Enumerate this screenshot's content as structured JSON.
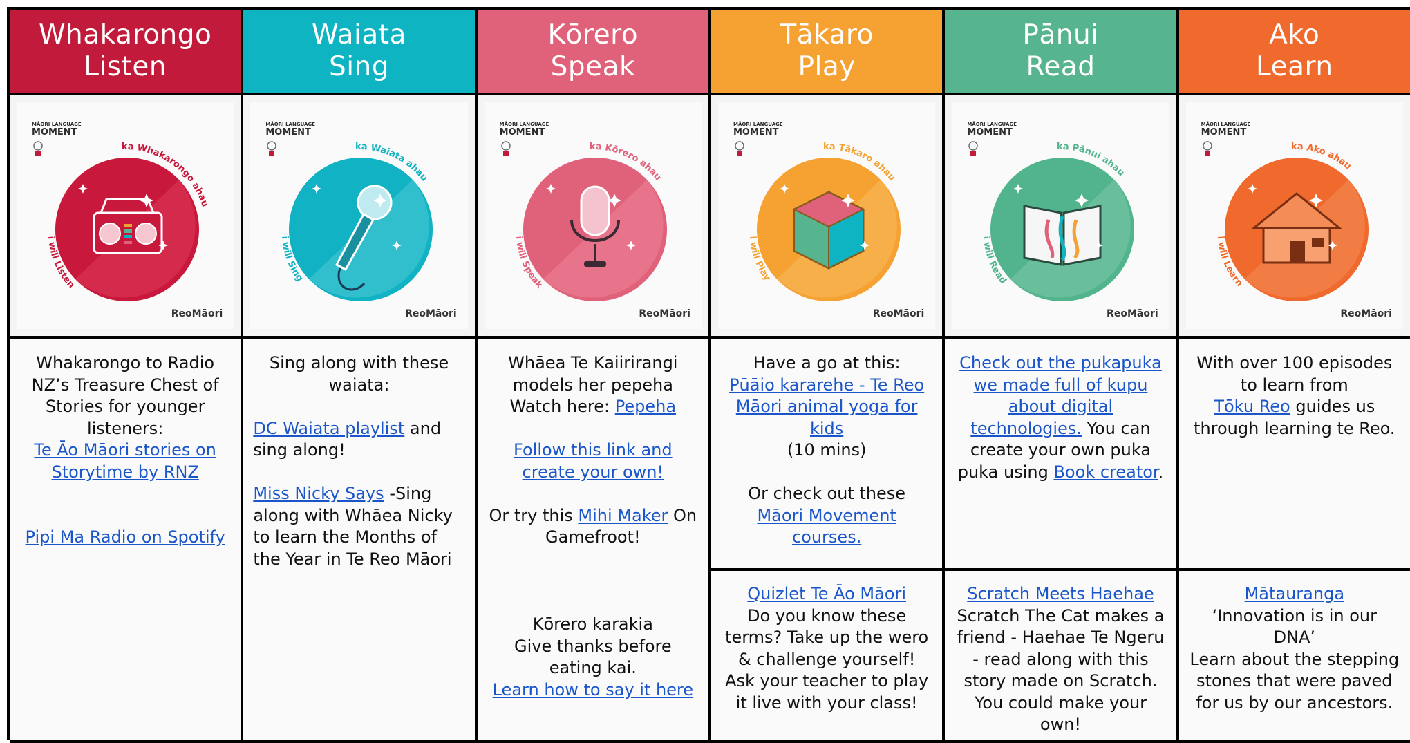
{
  "columns": [
    {
      "maori": "Whakarongo",
      "english": "Listen",
      "color": "#c21a3a",
      "card": {
        "brand_top": "MĀORI LANGUAGE",
        "brand_main": "MOMENT",
        "arc_top": "ka Whakarongo ahau",
        "arc_bottom": "i will Listen",
        "logo": "ReoMāori",
        "circle": "#c8183c",
        "circle_light": "#de3a57",
        "icon": "boombox-icon"
      }
    },
    {
      "maori": "Waiata",
      "english": "Sing",
      "color": "#0eb4c2",
      "card": {
        "brand_top": "MĀORI LANGUAGE",
        "brand_main": "MOMENT",
        "arc_top": "ka Waiata ahau",
        "arc_bottom": "i will Sing",
        "logo": "ReoMāori",
        "circle": "#10b2c4",
        "circle_light": "#4ccbd7",
        "icon": "microphone-icon"
      }
    },
    {
      "maori": "Kōrero",
      "english": "Speak",
      "color": "#e0617a",
      "card": {
        "brand_top": "MĀORI LANGUAGE",
        "brand_main": "MOMENT",
        "arc_top": "ka Kōrero ahau",
        "arc_bottom": "i will Speak",
        "logo": "ReoMāori",
        "circle": "#e0617a",
        "circle_light": "#ec8598",
        "icon": "studio-mic-icon"
      }
    },
    {
      "maori": "Tākaro",
      "english": "Play",
      "color": "#f5a233",
      "card": {
        "brand_top": "MĀORI LANGUAGE",
        "brand_main": "MOMENT",
        "arc_top": "ka Tākaro ahau",
        "arc_bottom": "i will Play",
        "logo": "ReoMāori",
        "circle": "#f5a233",
        "circle_light": "#f8bb5b",
        "icon": "cube-icon"
      }
    },
    {
      "maori": "Pānui",
      "english": "Read",
      "color": "#56b58e",
      "card": {
        "brand_top": "MĀORI LANGUAGE",
        "brand_main": "MOMENT",
        "arc_top": "ka Pānui ahau",
        "arc_bottom": "i will Read",
        "logo": "ReoMāori",
        "circle": "#52b48d",
        "circle_light": "#7cc8a8",
        "icon": "book-icon"
      }
    },
    {
      "maori": "Ako",
      "english": "Learn",
      "color": "#f06a2d",
      "card": {
        "brand_top": "MĀORI LANGUAGE",
        "brand_main": "MOMENT",
        "arc_top": "ka Ako ahau",
        "arc_bottom": "i will Learn",
        "logo": "ReoMāori",
        "circle": "#f06a2d",
        "circle_light": "#f48c58",
        "icon": "meeting-house-icon"
      }
    }
  ],
  "listen": {
    "intro": "Whakarongo to Radio NZ’s Treasure Chest of Stories for younger listeners:",
    "link1": "Te Āo Māori stories on Storytime by RNZ",
    "link2": "Pipi Ma Radio on Spotify"
  },
  "sing": {
    "intro": "Sing along with these waiata:",
    "link1": "DC Waiata playlist",
    "after1": " and sing along!",
    "link2": "Miss Nicky Says",
    "after2": " -Sing along with Whāea Nicky to learn the Months of the Year in Te Reo Māori"
  },
  "speak": {
    "intro": "Whāea Te Kaiirirangi models her pepeha",
    "watch": "Watch here: ",
    "link_pepeha": "Pepeha",
    "link_follow": "Follow this link and create your own!",
    "try": "Or try this ",
    "link_mihi": "Mihi Maker",
    "on": " On Gamefroot!",
    "karakia_title": "Kōrero karakia",
    "karakia_text": "Give thanks before eating kai.",
    "link_karakia": "Learn how to say it here"
  },
  "play": {
    "intro": "Have a go at this:",
    "link_yoga": "Pūāio kararehe - Te Reo Māori animal yoga for kids",
    "mins": "(10 mins)",
    "or": "Or check out  these",
    "link_move": "Māori Movement courses.",
    "link_quizlet": "Quizlet Te Āo Māori",
    "quiz_text": "Do you know these terms? Take up the wero & challenge yourself! Ask your teacher to play it live with your class!"
  },
  "read": {
    "link_puka": "Check out the pukapuka we made full of kupu about digital technologies.",
    "puka_text": " You can create your own puka puka using ",
    "link_book": "Book creator",
    "end": ".",
    "link_scratch": "Scratch Meets Haehae",
    "scratch_text": "Scratch The Cat makes a friend - Haehae Te Ngeru - read along with this story made on Scratch. You could make your own!"
  },
  "learn": {
    "intro": "With over 100 episodes to learn from",
    "link_toku": "Tōku Reo",
    "after": " guides us through learning te Reo.",
    "link_mat": "Mātauranga",
    "quote": "‘Innovation is in our DNA’",
    "mat_text": "Learn about the stepping stones that were paved for us by our ancestors."
  }
}
